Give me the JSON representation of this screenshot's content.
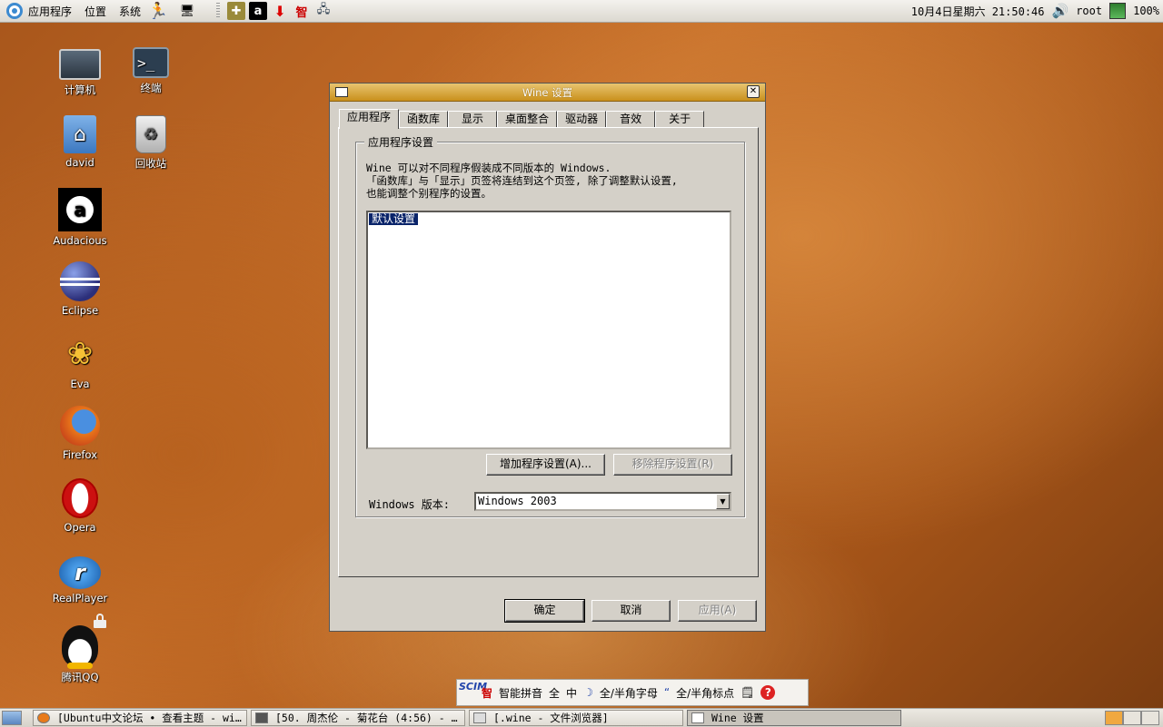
{
  "top_panel": {
    "menus": [
      "应用程序",
      "位置",
      "系统"
    ],
    "clock": "10月4日星期六 21:50:46",
    "user": "root",
    "battery": "100%"
  },
  "desktop_icons": [
    {
      "label": "计算机",
      "icon": "computer-icon"
    },
    {
      "label": "终端",
      "icon": "terminal-icon"
    },
    {
      "label": "david",
      "icon": "home-folder-icon"
    },
    {
      "label": "回收站",
      "icon": "trash-icon"
    },
    {
      "label": "Audacious",
      "icon": "audacious-icon",
      "glyph": "a"
    },
    {
      "label": "Eclipse",
      "icon": "eclipse-icon"
    },
    {
      "label": "Eva",
      "icon": "eva-icon"
    },
    {
      "label": "Firefox",
      "icon": "firefox-icon"
    },
    {
      "label": "Opera",
      "icon": "opera-icon"
    },
    {
      "label": "RealPlayer",
      "icon": "realplayer-icon",
      "glyph": "r"
    },
    {
      "label": "腾讯QQ",
      "icon": "qq-icon"
    }
  ],
  "dialog": {
    "title": "Wine 设置",
    "tabs": [
      "应用程序",
      "函数库",
      "显示",
      "桌面整合",
      "驱动器",
      "音效",
      "关于"
    ],
    "active_tab": "应用程序",
    "group_title": "应用程序设置",
    "description": "Wine 可以对不同程序假装成不同版本的 Windows.\n「函数库」与「显示」页签将连结到这个页签, 除了调整默认设置,\n也能调整个别程序的设置。",
    "app_list": [
      "默认设置"
    ],
    "add_button": "增加程序设置(A)...",
    "remove_button": "移除程序设置(R)",
    "version_label": "Windows 版本:",
    "version_value": "Windows 2003",
    "ok_button": "确定",
    "cancel_button": "取消",
    "apply_button": "应用(A)"
  },
  "ime_bar": {
    "logo": "SCIM",
    "zhi": "智",
    "mode": "智能拼音",
    "full": "全",
    "zhong": "中",
    "letter_width": "全/半角字母",
    "punct_width": "全/半角标点",
    "help": "?"
  },
  "taskbar": {
    "tasks": [
      "[Ubuntu中文论坛 • 查看主题 - wi…",
      "[50. 周杰伦 - 菊花台 (4:56) - …",
      "[.wine - 文件浏览器]",
      "Wine 设置"
    ]
  },
  "colors": {
    "title_bar": "#d8a83c",
    "selection": "#0a246a",
    "dialog_bg": "#d4d0c8"
  }
}
